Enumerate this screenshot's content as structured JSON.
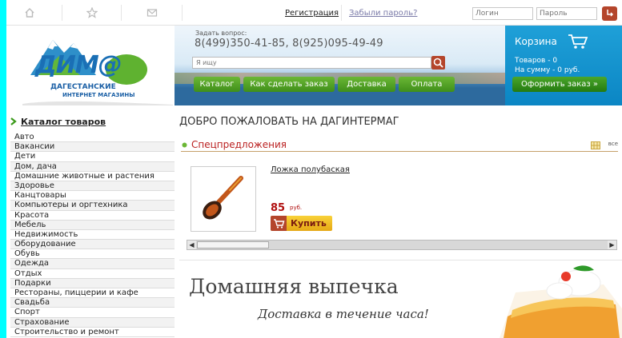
{
  "topbar": {
    "register_label": "Регистрация",
    "forgot_label": "Забыли пароль?",
    "login_placeholder": "Логин",
    "password_placeholder": "Пароль",
    "login_icon": "arrow-enter-icon"
  },
  "header": {
    "logo_main": "ДИМ@",
    "logo_line1": "ДАГЕСТАНСКИЕ",
    "logo_line2": "ИНТЕРНЕТ МАГАЗИНЫ",
    "ask_label": "Задать вопрос:",
    "phones": "8(499)350-41-85, 8(925)095-49-49",
    "search_placeholder": "Я ищу",
    "nav": [
      {
        "label": "Каталог"
      },
      {
        "label": "Как сделать заказ"
      },
      {
        "label": "Доставка"
      },
      {
        "label": "Оплата"
      }
    ]
  },
  "cart": {
    "title": "Корзина",
    "count_text": "Товаров - 0",
    "sum_text": "На сумму - 0 руб.",
    "checkout_label": "Оформить заказ »"
  },
  "sidebar": {
    "title": "Каталог товаров",
    "items": [
      "Авто",
      "Вакансии",
      "Дети",
      "Дом, дача",
      "Домашние животные и растения",
      "Здоровье",
      "Канцтовары",
      "Компьютеры и оргтехника",
      "Красота",
      "Мебель",
      "Недвижимость",
      "Оборудование",
      "Обувь",
      "Одежда",
      "Отдых",
      "Подарки",
      "Рестораны, пиццерии и кафе",
      "Свадьба",
      "Спорт",
      "Страхование",
      "Строительство и ремонт"
    ]
  },
  "main": {
    "welcome": "ДОБРО ПОЖАЛОВАТЬ НА ДАГИНТЕРМАГ",
    "special_title": "Спецпредложения",
    "all_label": "все",
    "product": {
      "name": "Ложка полубаская",
      "price": "85",
      "currency": "руб.",
      "buy_label": "Купить"
    },
    "promo": {
      "title": "Домашняя выпечка",
      "subtitle": "Доставка в течение часа!"
    }
  },
  "colors": {
    "accent_red": "#b4452b",
    "nav_green": "#4aa62a",
    "cart_blue": "#0b86c4",
    "price_red": "#b01010"
  }
}
